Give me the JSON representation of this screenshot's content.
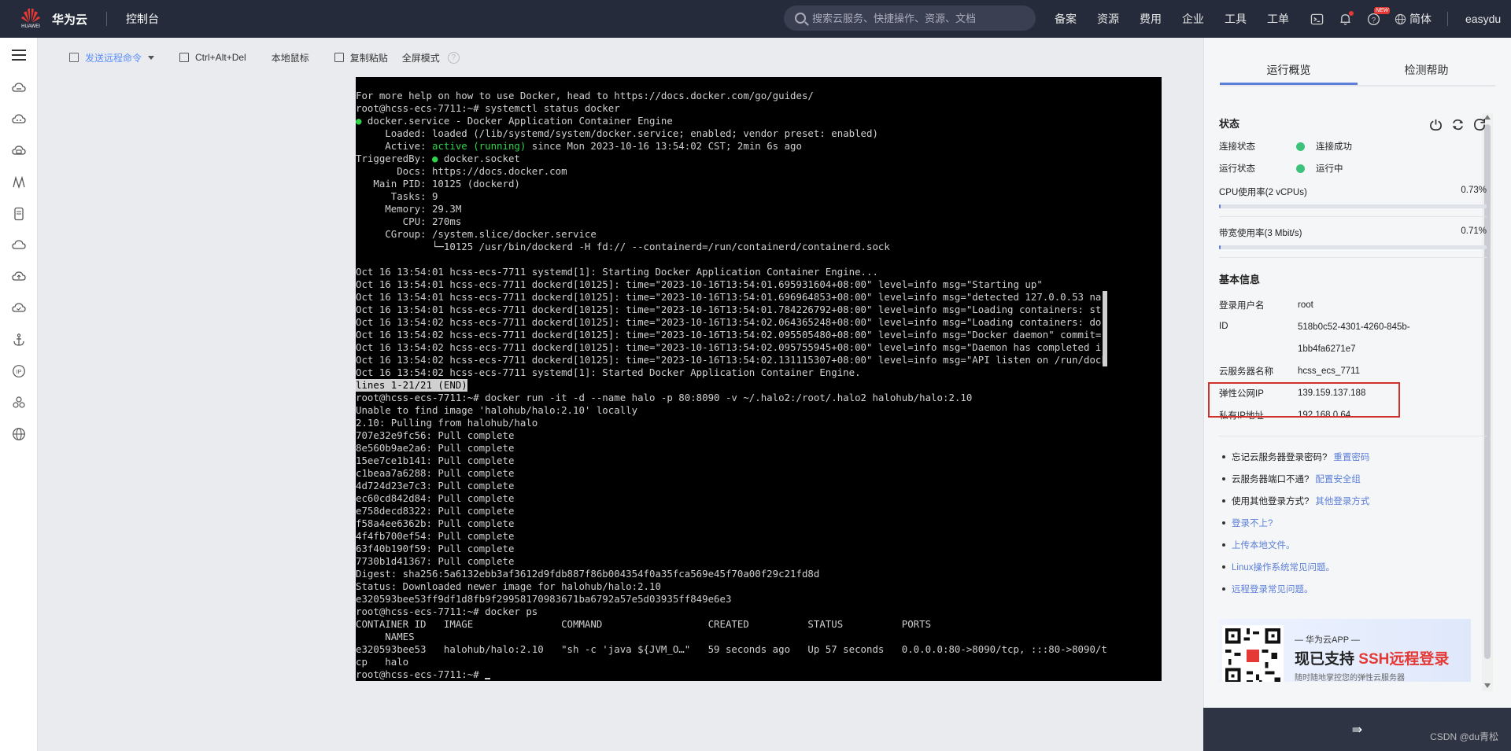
{
  "topbar": {
    "logo_text": "HUAWEI",
    "brand": "华为云",
    "console": "控制台",
    "search_placeholder": "搜索云服务、快捷操作、资源、文档",
    "nav": [
      "备案",
      "资源",
      "费用",
      "企业",
      "工具",
      "工单"
    ],
    "new_badge": "NEW",
    "lang": "简体",
    "user": "easydu"
  },
  "toolbar": {
    "send_cmd": "发送远程命令",
    "ctrl_alt_del": "Ctrl+Alt+Del",
    "local_mouse": "本地鼠标",
    "copy_paste": "复制粘贴",
    "fullscreen": "全屏模式"
  },
  "terminal": {
    "lines": [
      "For more help on how to use Docker, head to https://docs.docker.com/go/guides/",
      "root@hcss-ecs-7711:~# systemctl status docker",
      "● docker.service - Docker Application Container Engine",
      "     Loaded: loaded (/lib/systemd/system/docker.service; enabled; vendor preset: enabled)",
      "     Active: active (running) since Mon 2023-10-16 13:54:02 CST; 2min 6s ago",
      "TriggeredBy: ● docker.socket",
      "       Docs: https://docs.docker.com",
      "   Main PID: 10125 (dockerd)",
      "      Tasks: 9",
      "     Memory: 29.3M",
      "        CPU: 270ms",
      "     CGroup: /system.slice/docker.service",
      "             └─10125 /usr/bin/dockerd -H fd:// --containerd=/run/containerd/containerd.sock",
      "",
      "Oct 16 13:54:01 hcss-ecs-7711 systemd[1]: Starting Docker Application Container Engine...",
      "Oct 16 13:54:01 hcss-ecs-7711 dockerd[10125]: time=\"2023-10-16T13:54:01.695931604+08:00\" level=info msg=\"Starting up\"",
      "Oct 16 13:54:01 hcss-ecs-7711 dockerd[10125]: time=\"2023-10-16T13:54:01.696964853+08:00\" level=info msg=\"detected 127.0.0.53 na",
      "Oct 16 13:54:01 hcss-ecs-7711 dockerd[10125]: time=\"2023-10-16T13:54:01.784226792+08:00\" level=info msg=\"Loading containers: st",
      "Oct 16 13:54:02 hcss-ecs-7711 dockerd[10125]: time=\"2023-10-16T13:54:02.064365248+08:00\" level=info msg=\"Loading containers: do",
      "Oct 16 13:54:02 hcss-ecs-7711 dockerd[10125]: time=\"2023-10-16T13:54:02.095505480+08:00\" level=info msg=\"Docker daemon\" commit=",
      "Oct 16 13:54:02 hcss-ecs-7711 dockerd[10125]: time=\"2023-10-16T13:54:02.095755945+08:00\" level=info msg=\"Daemon has completed i",
      "Oct 16 13:54:02 hcss-ecs-7711 dockerd[10125]: time=\"2023-10-16T13:54:02.131115307+08:00\" level=info msg=\"API listen on /run/dock",
      "Oct 16 13:54:02 hcss-ecs-7711 systemd[1]: Started Docker Application Container Engine.",
      "lines 1-21/21 (END)",
      "root@hcss-ecs-7711:~# docker run -it -d --name halo -p 80:8090 -v ~/.halo2:/root/.halo2 halohub/halo:2.10",
      "Unable to find image 'halohub/halo:2.10' locally",
      "2.10: Pulling from halohub/halo",
      "707e32e9fc56: Pull complete",
      "8e560b9ae2a6: Pull complete",
      "15ee7ce1b141: Pull complete",
      "c1beaa7a6288: Pull complete",
      "4d724d23e7c3: Pull complete",
      "ec60cd842d84: Pull complete",
      "e758decd8322: Pull complete",
      "f58a4ee6362b: Pull complete",
      "4f4fb700ef54: Pull complete",
      "63f40b190f59: Pull complete",
      "7730b1d41367: Pull complete",
      "Digest: sha256:5a6132ebb3af3612d9fdb887f86b004354f0a35fca569e45f70a00f29c21fd8d",
      "Status: Downloaded newer image for halohub/halo:2.10",
      "e320593bee53ff9df1d8fb9f29958170983671ba6792a57e5d03935ff849e6e3",
      "root@hcss-ecs-7711:~# docker ps",
      "CONTAINER ID   IMAGE               COMMAND                  CREATED          STATUS          PORTS",
      "     NAMES",
      "e320593bee53   halohub/halo:2.10   \"sh -c 'java ${JVM_O…\"   59 seconds ago   Up 57 seconds   0.0.0.0:80->8090/tcp, :::80->8090/t",
      "cp   halo",
      "root@hcss-ecs-7711:~# "
    ]
  },
  "panel": {
    "tabs": [
      "运行概览",
      "检测帮助"
    ],
    "status_title": "状态",
    "conn_label": "连接状态",
    "conn_value": "连接成功",
    "run_label": "运行状态",
    "run_value": "运行中",
    "cpu_label": "CPU使用率(2 vCPUs)",
    "cpu_value": "0.73%",
    "cpu_usage": 0.0073,
    "bw_label": "带宽使用率(3 Mbit/s)",
    "bw_value": "0.71%",
    "bw_usage": 0.0071,
    "basic_title": "基本信息",
    "login_user_label": "登录用户名",
    "login_user": "root",
    "id_label": "ID",
    "id_line1": "518b0c52-4301-4260-845b-",
    "id_line2": "1bb4fa6271e7",
    "server_name_label": "云服务器名称",
    "server_name": "hcss_ecs_7711",
    "eip_label": "弹性公网IP",
    "eip": "139.159.137.188",
    "private_ip_label": "私有IP地址",
    "private_ip": "192.168.0.64",
    "links": [
      {
        "text": "忘记云服务器登录密码?",
        "link": "重置密码"
      },
      {
        "text": "云服务器端口不通?",
        "link": "配置安全组"
      },
      {
        "text": "使用其他登录方式?",
        "link": "其他登录方式"
      },
      {
        "text": "",
        "link": "登录不上?"
      },
      {
        "text": "",
        "link": "上传本地文件。"
      },
      {
        "text": "",
        "link": "Linux操作系统常见问题。"
      },
      {
        "text": "",
        "link": "远程登录常见问题。"
      }
    ],
    "promo_line1": "— 华为云APP —",
    "promo_line2_a": "现已支持 ",
    "promo_line2_b": "SSH远程登录",
    "promo_line3": "随时随地掌控您的弹性云服务器",
    "collapse_icon": "⇛"
  },
  "watermark": "CSDN @du青松",
  "colors": {
    "topbar_bg": "#252b3a",
    "accent": "#5b7fd8",
    "highlight_border": "#d0312d",
    "green": "#3cc27a"
  }
}
